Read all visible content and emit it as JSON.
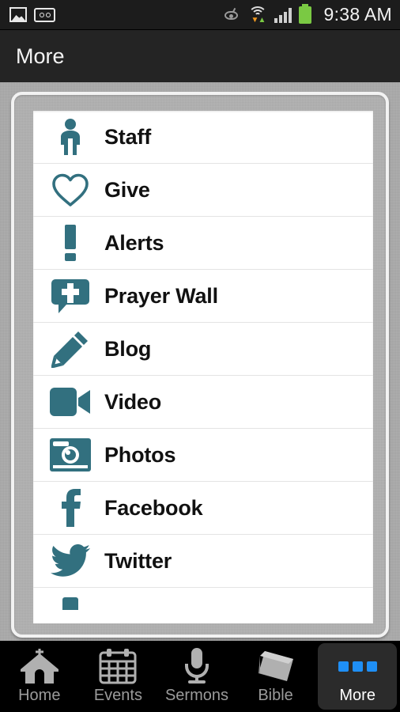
{
  "statusbar": {
    "left_icons": [
      {
        "name": "screenshot-image-icon"
      },
      {
        "name": "voicemail-icon"
      }
    ],
    "right_icons": [
      {
        "name": "smart-stay-eye-icon"
      },
      {
        "name": "wifi-icon"
      },
      {
        "name": "cell-signal-icon"
      },
      {
        "name": "battery-icon"
      }
    ],
    "clock": "9:38 AM"
  },
  "header": {
    "title": "More"
  },
  "list": {
    "items": [
      {
        "label": "Staff",
        "icon": "person-icon"
      },
      {
        "label": "Give",
        "icon": "heart-outline-icon"
      },
      {
        "label": "Alerts",
        "icon": "exclamation-icon"
      },
      {
        "label": "Prayer Wall",
        "icon": "speech-bubble-cross-icon"
      },
      {
        "label": "Blog",
        "icon": "pencil-icon"
      },
      {
        "label": "Video",
        "icon": "video-camera-icon"
      },
      {
        "label": "Photos",
        "icon": "camera-icon"
      },
      {
        "label": "Facebook",
        "icon": "facebook-icon"
      },
      {
        "label": "Twitter",
        "icon": "twitter-bird-icon"
      }
    ],
    "partial_item": {
      "label": "",
      "icon": "partial-icon"
    }
  },
  "tabbar": {
    "tabs": [
      {
        "label": "Home",
        "icon": "church-icon",
        "active": false
      },
      {
        "label": "Events",
        "icon": "calendar-icon",
        "active": false
      },
      {
        "label": "Sermons",
        "icon": "microphone-icon",
        "active": false
      },
      {
        "label": "Bible",
        "icon": "book-icon",
        "active": false
      },
      {
        "label": "More",
        "icon": "three-dots-icon",
        "active": true
      }
    ]
  },
  "colors": {
    "icon_teal": "#32707f",
    "accent_blue": "#1f8ff5",
    "titlebar_bg": "#242424",
    "statusbar_bg": "#1c1c1c",
    "battery_green": "#7ac943"
  }
}
